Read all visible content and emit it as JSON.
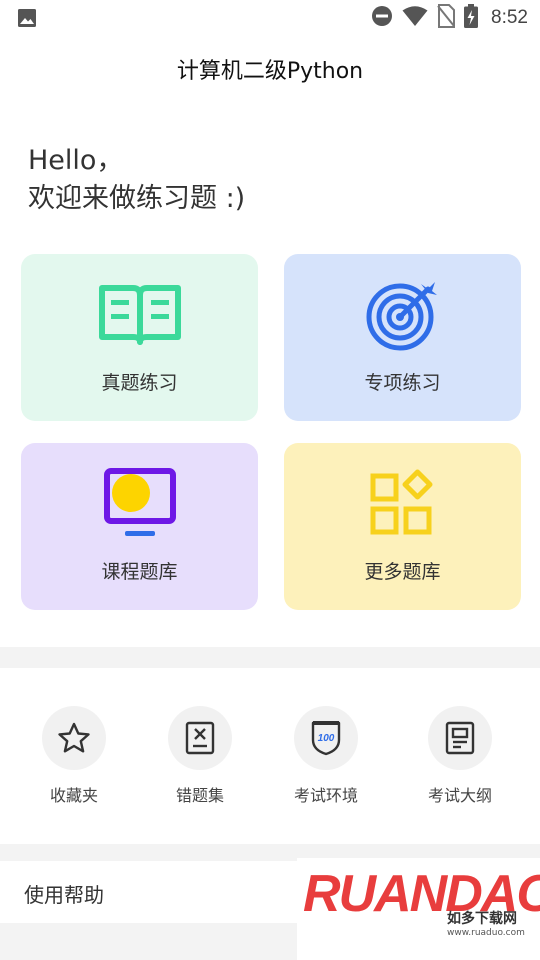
{
  "status_bar": {
    "time": "8:52",
    "icons": [
      "image-icon",
      "do-not-disturb-icon",
      "wifi-icon",
      "no-sim-icon",
      "battery-charging-icon"
    ]
  },
  "app_bar": {
    "title": "计算机二级Python"
  },
  "greeting": {
    "line1": "Hello，",
    "line2": "欢迎来做练习题 :)"
  },
  "cards": [
    {
      "label": "真题练习",
      "icon": "book-icon",
      "bg": "#e3f8ee",
      "accent": "#3bd99a"
    },
    {
      "label": "专项练习",
      "icon": "target-icon",
      "bg": "#d6e3fb",
      "accent": "#2f6de8"
    },
    {
      "label": "课程题库",
      "icon": "monitor-icon",
      "bg": "#e7defc",
      "accent": "#6e18e6"
    },
    {
      "label": "更多题库",
      "icon": "apps-grid-icon",
      "bg": "#fdf1bb",
      "accent": "#f7d11c"
    }
  ],
  "quick_links": [
    {
      "label": "收藏夹",
      "icon": "star-icon"
    },
    {
      "label": "错题集",
      "icon": "wrong-answers-icon"
    },
    {
      "label": "考试环境",
      "icon": "exam-badge-icon",
      "badge_text": "100"
    },
    {
      "label": "考试大纲",
      "icon": "outline-doc-icon"
    }
  ],
  "help": {
    "label": "使用帮助"
  },
  "watermark": {
    "logo": "RUANDAO",
    "sub": "如多下载网",
    "url": "www.ruaduo.com"
  }
}
